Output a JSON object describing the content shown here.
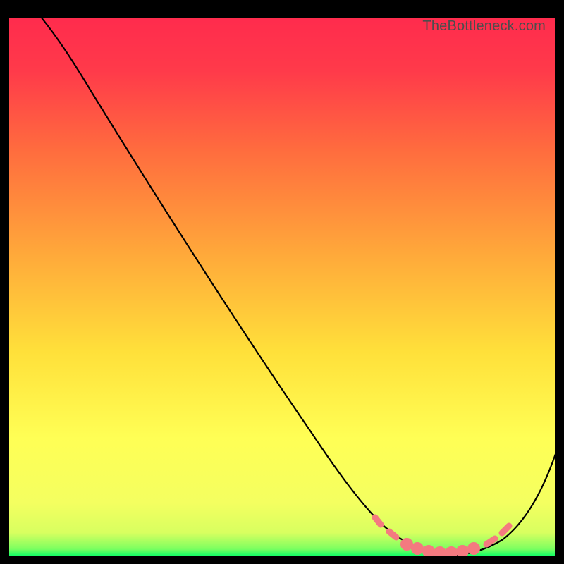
{
  "attribution": "TheBottleneck.com",
  "chart_data": {
    "type": "line",
    "title": "",
    "xlabel": "",
    "ylabel": "",
    "xlim": [
      0,
      100
    ],
    "ylim": [
      0,
      100
    ],
    "grid": false,
    "legend": false,
    "background_gradient": {
      "top": "#ff2b4d",
      "mid_upper": "#ff8a3c",
      "mid": "#ffd93a",
      "mid_lower": "#ffff5a",
      "bottom": "#00ff66"
    },
    "series": [
      {
        "name": "curve",
        "color": "#000000",
        "x": [
          6,
          10,
          20,
          30,
          40,
          50,
          58,
          62,
          66,
          70,
          75,
          80,
          85,
          90,
          95,
          100
        ],
        "y": [
          100,
          96,
          83,
          70,
          56,
          42,
          30,
          22,
          12,
          5,
          1,
          0,
          0,
          3,
          10,
          20
        ]
      },
      {
        "name": "marker-band",
        "type": "scatter",
        "color": "#f47a80",
        "x": [
          68,
          72,
          75,
          78,
          81,
          84,
          87,
          90
        ],
        "y": [
          8,
          4,
          1,
          0,
          0,
          0,
          1,
          3
        ]
      }
    ],
    "optimum_range_x": [
      75,
      88
    ]
  }
}
